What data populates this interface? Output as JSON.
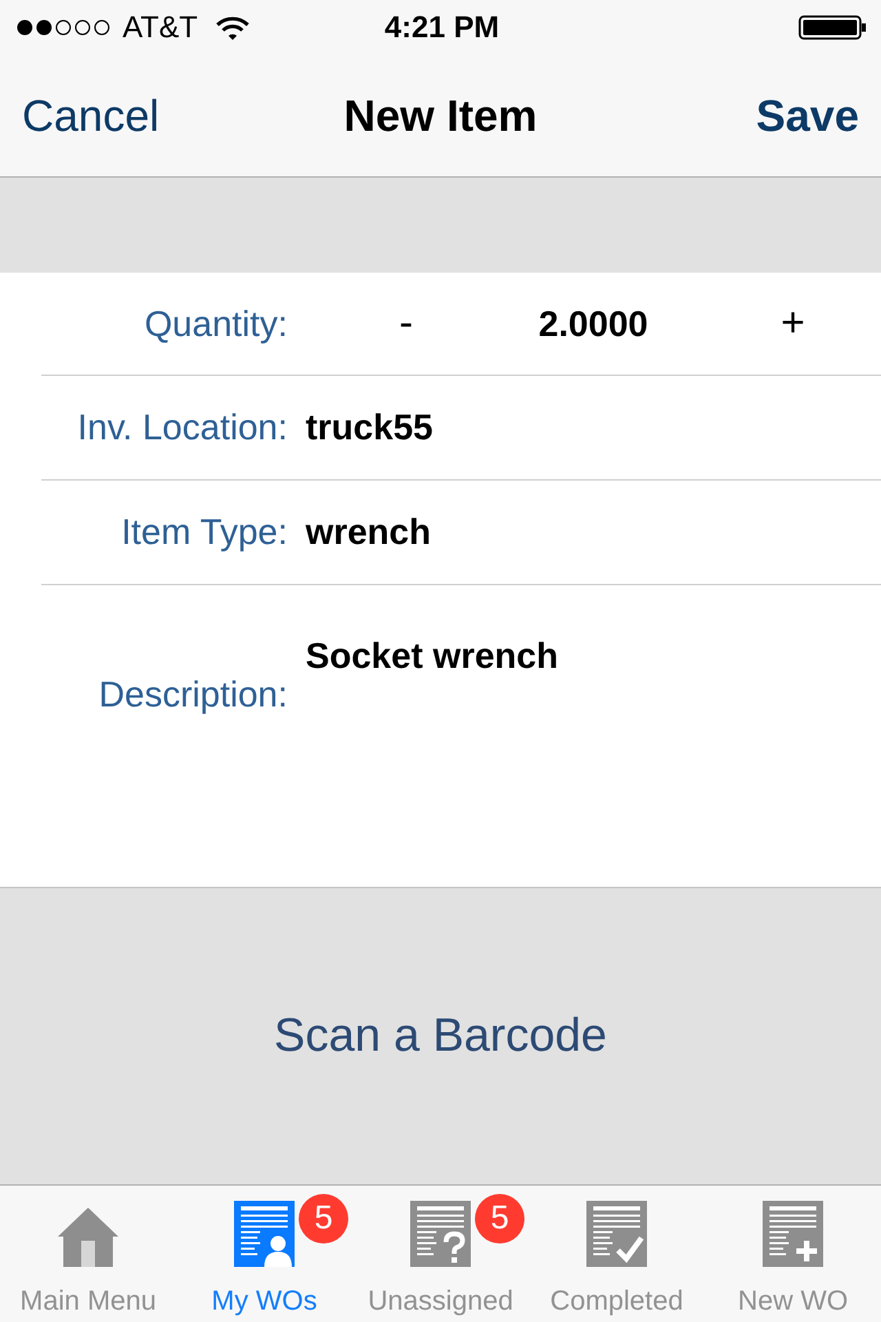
{
  "status_bar": {
    "carrier": "AT&T",
    "time": "4:21 PM"
  },
  "nav_bar": {
    "cancel": "Cancel",
    "title": "New Item",
    "save": "Save"
  },
  "form": {
    "rows": [
      {
        "kind": "stepper",
        "label": "Quantity:",
        "decrement": "-",
        "value": "2.0000",
        "increment": "+"
      },
      {
        "kind": "text",
        "label": "Inv. Location:",
        "value": "truck55"
      },
      {
        "kind": "text",
        "label": "Item Type:",
        "value": "wrench"
      },
      {
        "kind": "multiline",
        "label": "Description:",
        "value": "Socket wrench"
      }
    ]
  },
  "scan_button": {
    "label": "Scan a Barcode"
  },
  "tab_bar": {
    "items": [
      {
        "kind": "home",
        "label": "Main Menu",
        "selected": false
      },
      {
        "kind": "person",
        "label": "My WOs",
        "selected": true,
        "badge": "5"
      },
      {
        "kind": "question",
        "label": "Unassigned",
        "selected": false,
        "badge": "5"
      },
      {
        "kind": "check",
        "label": "Completed",
        "selected": false
      },
      {
        "kind": "plus",
        "label": "New WO",
        "selected": false
      }
    ]
  }
}
